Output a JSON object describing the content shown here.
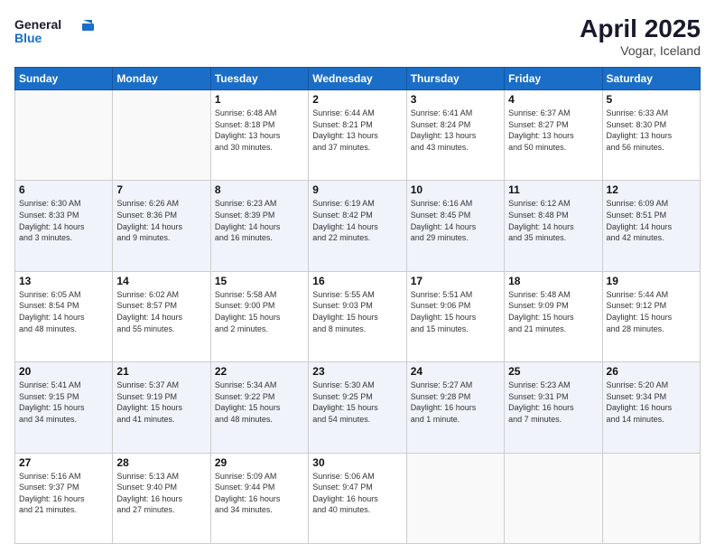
{
  "header": {
    "logo": {
      "line1": "General",
      "line2": "Blue"
    },
    "title": "April 2025",
    "subtitle": "Vogar, Iceland"
  },
  "weekdays": [
    "Sunday",
    "Monday",
    "Tuesday",
    "Wednesday",
    "Thursday",
    "Friday",
    "Saturday"
  ],
  "weeks": [
    [
      {
        "day": null,
        "info": null
      },
      {
        "day": null,
        "info": null
      },
      {
        "day": "1",
        "info": "Sunrise: 6:48 AM\nSunset: 8:18 PM\nDaylight: 13 hours\nand 30 minutes."
      },
      {
        "day": "2",
        "info": "Sunrise: 6:44 AM\nSunset: 8:21 PM\nDaylight: 13 hours\nand 37 minutes."
      },
      {
        "day": "3",
        "info": "Sunrise: 6:41 AM\nSunset: 8:24 PM\nDaylight: 13 hours\nand 43 minutes."
      },
      {
        "day": "4",
        "info": "Sunrise: 6:37 AM\nSunset: 8:27 PM\nDaylight: 13 hours\nand 50 minutes."
      },
      {
        "day": "5",
        "info": "Sunrise: 6:33 AM\nSunset: 8:30 PM\nDaylight: 13 hours\nand 56 minutes."
      }
    ],
    [
      {
        "day": "6",
        "info": "Sunrise: 6:30 AM\nSunset: 8:33 PM\nDaylight: 14 hours\nand 3 minutes."
      },
      {
        "day": "7",
        "info": "Sunrise: 6:26 AM\nSunset: 8:36 PM\nDaylight: 14 hours\nand 9 minutes."
      },
      {
        "day": "8",
        "info": "Sunrise: 6:23 AM\nSunset: 8:39 PM\nDaylight: 14 hours\nand 16 minutes."
      },
      {
        "day": "9",
        "info": "Sunrise: 6:19 AM\nSunset: 8:42 PM\nDaylight: 14 hours\nand 22 minutes."
      },
      {
        "day": "10",
        "info": "Sunrise: 6:16 AM\nSunset: 8:45 PM\nDaylight: 14 hours\nand 29 minutes."
      },
      {
        "day": "11",
        "info": "Sunrise: 6:12 AM\nSunset: 8:48 PM\nDaylight: 14 hours\nand 35 minutes."
      },
      {
        "day": "12",
        "info": "Sunrise: 6:09 AM\nSunset: 8:51 PM\nDaylight: 14 hours\nand 42 minutes."
      }
    ],
    [
      {
        "day": "13",
        "info": "Sunrise: 6:05 AM\nSunset: 8:54 PM\nDaylight: 14 hours\nand 48 minutes."
      },
      {
        "day": "14",
        "info": "Sunrise: 6:02 AM\nSunset: 8:57 PM\nDaylight: 14 hours\nand 55 minutes."
      },
      {
        "day": "15",
        "info": "Sunrise: 5:58 AM\nSunset: 9:00 PM\nDaylight: 15 hours\nand 2 minutes."
      },
      {
        "day": "16",
        "info": "Sunrise: 5:55 AM\nSunset: 9:03 PM\nDaylight: 15 hours\nand 8 minutes."
      },
      {
        "day": "17",
        "info": "Sunrise: 5:51 AM\nSunset: 9:06 PM\nDaylight: 15 hours\nand 15 minutes."
      },
      {
        "day": "18",
        "info": "Sunrise: 5:48 AM\nSunset: 9:09 PM\nDaylight: 15 hours\nand 21 minutes."
      },
      {
        "day": "19",
        "info": "Sunrise: 5:44 AM\nSunset: 9:12 PM\nDaylight: 15 hours\nand 28 minutes."
      }
    ],
    [
      {
        "day": "20",
        "info": "Sunrise: 5:41 AM\nSunset: 9:15 PM\nDaylight: 15 hours\nand 34 minutes."
      },
      {
        "day": "21",
        "info": "Sunrise: 5:37 AM\nSunset: 9:19 PM\nDaylight: 15 hours\nand 41 minutes."
      },
      {
        "day": "22",
        "info": "Sunrise: 5:34 AM\nSunset: 9:22 PM\nDaylight: 15 hours\nand 48 minutes."
      },
      {
        "day": "23",
        "info": "Sunrise: 5:30 AM\nSunset: 9:25 PM\nDaylight: 15 hours\nand 54 minutes."
      },
      {
        "day": "24",
        "info": "Sunrise: 5:27 AM\nSunset: 9:28 PM\nDaylight: 16 hours\nand 1 minute."
      },
      {
        "day": "25",
        "info": "Sunrise: 5:23 AM\nSunset: 9:31 PM\nDaylight: 16 hours\nand 7 minutes."
      },
      {
        "day": "26",
        "info": "Sunrise: 5:20 AM\nSunset: 9:34 PM\nDaylight: 16 hours\nand 14 minutes."
      }
    ],
    [
      {
        "day": "27",
        "info": "Sunrise: 5:16 AM\nSunset: 9:37 PM\nDaylight: 16 hours\nand 21 minutes."
      },
      {
        "day": "28",
        "info": "Sunrise: 5:13 AM\nSunset: 9:40 PM\nDaylight: 16 hours\nand 27 minutes."
      },
      {
        "day": "29",
        "info": "Sunrise: 5:09 AM\nSunset: 9:44 PM\nDaylight: 16 hours\nand 34 minutes."
      },
      {
        "day": "30",
        "info": "Sunrise: 5:06 AM\nSunset: 9:47 PM\nDaylight: 16 hours\nand 40 minutes."
      },
      {
        "day": null,
        "info": null
      },
      {
        "day": null,
        "info": null
      },
      {
        "day": null,
        "info": null
      }
    ]
  ]
}
